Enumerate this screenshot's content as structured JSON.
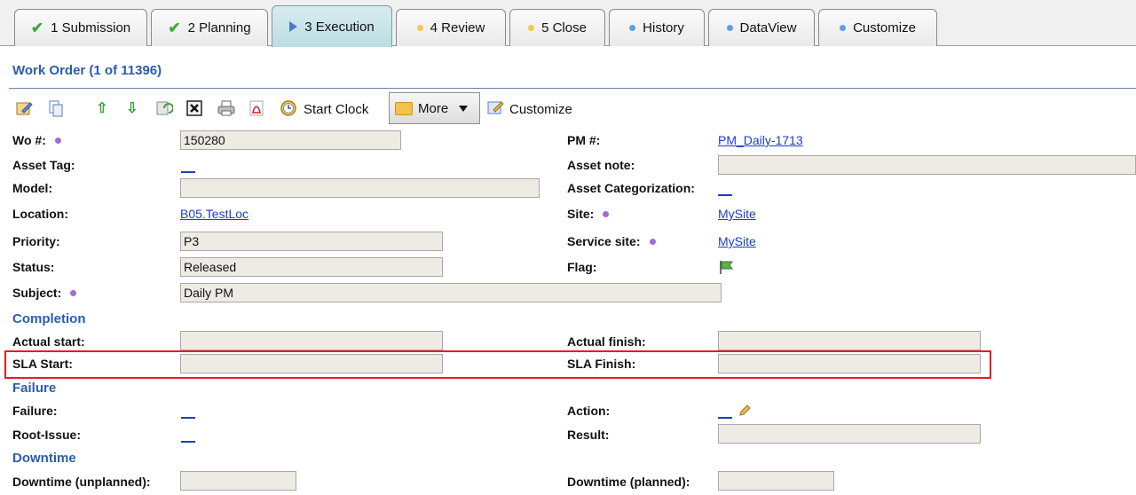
{
  "tabs": [
    {
      "label": "1 Submission",
      "icon": "check-icon"
    },
    {
      "label": "2 Planning",
      "icon": "check-icon"
    },
    {
      "label": "3 Execution",
      "icon": "play-icon"
    },
    {
      "label": "4 Review",
      "icon": "dot-icon",
      "dot_color": "#f2c94c"
    },
    {
      "label": "5 Close",
      "icon": "dot-icon",
      "dot_color": "#f2c94c"
    },
    {
      "label": "History",
      "icon": "dot-icon",
      "dot_color": "#5aa0e6"
    },
    {
      "label": "DataView",
      "icon": "dot-icon",
      "dot_color": "#5aa0e6"
    },
    {
      "label": "Customize",
      "icon": "dot-icon",
      "dot_color": "#5aa0e6"
    }
  ],
  "title": "Work Order (1 of 11396)",
  "toolbar": {
    "start_clock": "Start Clock",
    "more": "More",
    "customize": "Customize"
  },
  "form": {
    "wo_label": "Wo #:",
    "wo_value": "150280",
    "pm_label": "PM #:",
    "pm_value": "PM_Daily-1713",
    "asset_tag_label": "Asset Tag:",
    "asset_note_label": "Asset note:",
    "model_label": "Model:",
    "asset_cat_label": "Asset Categorization:",
    "location_label": "Location:",
    "location_value": "B05.TestLoc",
    "site_label": "Site:",
    "site_value": "MySite",
    "priority_label": "Priority:",
    "priority_value": "P3",
    "service_site_label": "Service site:",
    "service_site_value": "MySite",
    "status_label": "Status:",
    "status_value": "Released",
    "flag_label": "Flag:",
    "subject_label": "Subject:",
    "subject_value": "Daily PM"
  },
  "completion": {
    "title": "Completion",
    "actual_start_label": "Actual start:",
    "actual_finish_label": "Actual finish:",
    "sla_start_label": "SLA Start:",
    "sla_finish_label": "SLA Finish:"
  },
  "failure": {
    "title": "Failure",
    "failure_label": "Failure:",
    "action_label": "Action:",
    "root_issue_label": "Root-Issue:",
    "result_label": "Result:"
  },
  "downtime": {
    "title": "Downtime",
    "unplanned_label": "Downtime (unplanned):",
    "planned_label": "Downtime (planned):"
  },
  "colors": {
    "accent": "#2a5db0",
    "link": "#1a3fc4",
    "highlight": "#e02020"
  }
}
